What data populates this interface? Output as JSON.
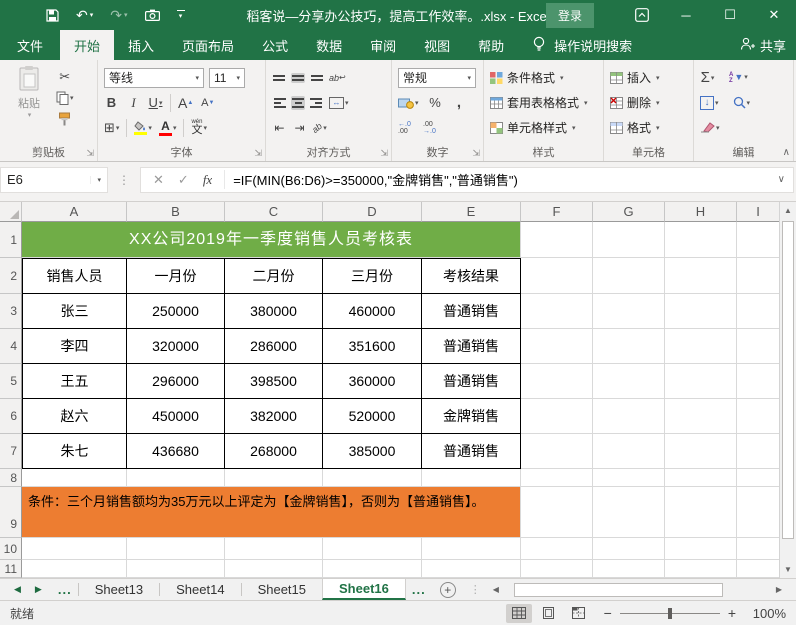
{
  "colors": {
    "excel_green": "#217346",
    "title_fill": "#70AD47",
    "note_fill": "#ED7D31",
    "active_tab_text": "#217346"
  },
  "titlebar": {
    "title": "稻客说—分享办公技巧，提高工作效率。.xlsx - Excel",
    "login": "登录"
  },
  "tabrow": {
    "file": "文件",
    "tabs": [
      "开始",
      "插入",
      "页面布局",
      "公式",
      "数据",
      "审阅",
      "视图",
      "帮助"
    ],
    "active_tab": "开始",
    "search_label": "操作说明搜索",
    "share": "共享"
  },
  "ribbon": {
    "clipboard": {
      "label": "剪贴板",
      "paste": "粘贴"
    },
    "font": {
      "label": "字体",
      "name": "等线",
      "size": "11",
      "bold": "B",
      "italic": "I",
      "underline": "U",
      "grow_letter": "A",
      "shrink_letter": "A",
      "font_color_letter": "A",
      "phonetic": "文",
      "phonetic_ruby": "wén"
    },
    "alignment": {
      "label": "对齐方式",
      "orient": "ab",
      "wrap": "ab"
    },
    "number": {
      "label": "数字",
      "format": "常规",
      "percent": "%",
      "comma": ",",
      "inc_dec_top": "←.0",
      "inc_dec_bot": ".00",
      "dec_dec_top": ".00",
      "dec_dec_bot": "→.0"
    },
    "styles": {
      "label": "样式",
      "conditional": "条件格式",
      "format_table": "套用表格格式",
      "cell_styles": "单元格样式"
    },
    "cells": {
      "label": "单元格",
      "insert": "插入",
      "delete": "删除",
      "format": "格式"
    },
    "editing": {
      "label": "编辑",
      "autosum": "Σ",
      "sort_a": "A",
      "sort_z": "Z",
      "fill_arrow": "↓"
    }
  },
  "formula_bar": {
    "name_box": "E6",
    "cancel": "✕",
    "enter": "✓",
    "fx": "fx",
    "formula": "=IF(MIN(B6:D6)>=350000,\"金牌销售\",\"普通销售\")"
  },
  "sheet": {
    "col_labels": [
      "A",
      "B",
      "C",
      "D",
      "E",
      "F",
      "G",
      "H",
      "I"
    ],
    "row_labels": [
      "1",
      "2",
      "3",
      "4",
      "5",
      "6",
      "7",
      "8",
      "9",
      "10",
      "11"
    ],
    "title": "XX公司2019年一季度销售人员考核表",
    "table": {
      "headers": [
        "销售人员",
        "一月份",
        "二月份",
        "三月份",
        "考核结果"
      ],
      "rows": [
        [
          "张三",
          "250000",
          "380000",
          "460000",
          "普通销售"
        ],
        [
          "李四",
          "320000",
          "286000",
          "351600",
          "普通销售"
        ],
        [
          "王五",
          "296000",
          "398500",
          "360000",
          "普通销售"
        ],
        [
          "赵六",
          "450000",
          "382000",
          "520000",
          "金牌销售"
        ],
        [
          "朱七",
          "436680",
          "268000",
          "385000",
          "普通销售"
        ]
      ]
    },
    "note": "条件：三个月销售额均为35万元以上评定为【金牌销售】，否则为【普通销售】。"
  },
  "sheet_tabs": {
    "more_left": "...",
    "sheets": [
      "Sheet13",
      "Sheet14",
      "Sheet15",
      "Sheet16"
    ],
    "active": "Sheet16",
    "more_right": "...",
    "add": "+"
  },
  "status_bar": {
    "ready": "就绪",
    "zoom": "100%",
    "zoom_out": "−",
    "zoom_in": "+"
  }
}
